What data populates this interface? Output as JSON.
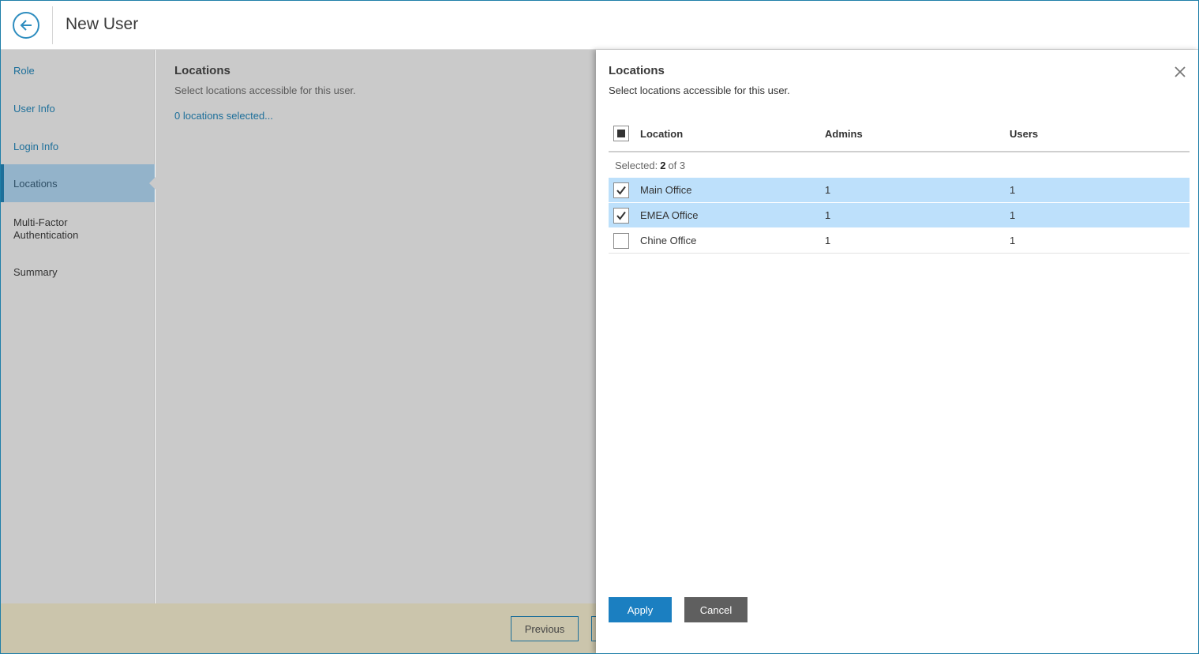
{
  "header": {
    "title": "New User",
    "back_icon": "arrow-left-icon"
  },
  "sidebar": {
    "items": [
      {
        "label": "Role"
      },
      {
        "label": "User Info"
      },
      {
        "label": "Login Info"
      },
      {
        "label": "Locations",
        "active": true
      },
      {
        "label": "Multi-Factor Authentication"
      },
      {
        "label": "Summary"
      }
    ]
  },
  "main": {
    "title": "Locations",
    "description": "Select locations accessible for this user.",
    "link": "0 locations selected..."
  },
  "footer": {
    "previous_label": "Previous"
  },
  "panel": {
    "title": "Locations",
    "description": "Select locations accessible for this user.",
    "close_icon": "close-icon",
    "columns": {
      "location": "Location",
      "admins": "Admins",
      "users": "Users"
    },
    "selected_label": "Selected:",
    "selected_count": "2",
    "selected_of": "of 3",
    "rows": [
      {
        "location": "Main Office",
        "admins": "1",
        "users": "1",
        "checked": true
      },
      {
        "location": "EMEA Office",
        "admins": "1",
        "users": "1",
        "checked": true
      },
      {
        "location": "Chine Office",
        "admins": "1",
        "users": "1",
        "checked": false
      }
    ],
    "apply_label": "Apply",
    "cancel_label": "Cancel"
  },
  "colors": {
    "accent": "#1b7fc1",
    "selected_row": "#bde0fb",
    "active_nav": "#93b3ca",
    "overlay": "#cacaca",
    "footer": "#cbc5ac"
  }
}
